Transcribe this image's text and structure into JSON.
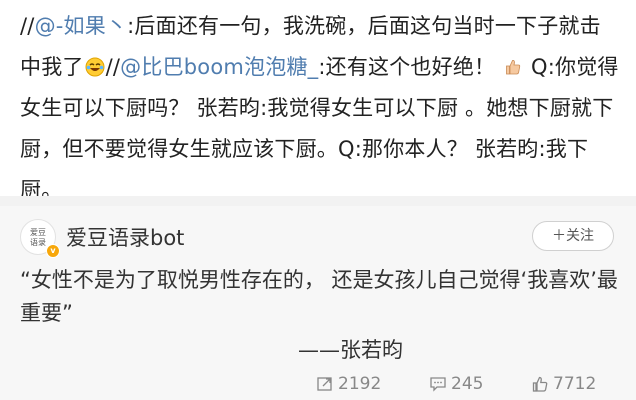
{
  "post": {
    "prefix": "//",
    "mention1": "@-如果丶",
    "text1": ":后面还有一句，我洗碗，后面这句当时一下子就击中我了",
    "emoji1": "laughing-crying-emoji",
    "sep": "//",
    "mention2": "@比巴boom泡泡糖_",
    "text2": ":还有这个也好绝！",
    "emoji2": "thumbs-up-emoji",
    "text3": " Q:你觉得女生可以下厨吗？ 张若昀:我觉得女生可以下厨 。她想下厨就下厨，但不要觉得女生就应该下厨。Q:那你本人？ 张若昀:我下厨。"
  },
  "card": {
    "avatar_text_line1": "爱豆",
    "avatar_text_line2": "语录",
    "username": "爱豆语录bot",
    "follow_label": "＋关注",
    "quote": "“女性不是为了取悦男性存在的， 还是女孩儿自己觉得‘我喜欢’最重要”",
    "signature": "——张若昀",
    "reposts": "2192",
    "comments": "245",
    "likes": "7712"
  },
  "colors": {
    "mention": "#507daf",
    "text": "#222222",
    "muted": "#888888",
    "card_bg": "#f7f7f7",
    "verified": "#f7a70a"
  }
}
